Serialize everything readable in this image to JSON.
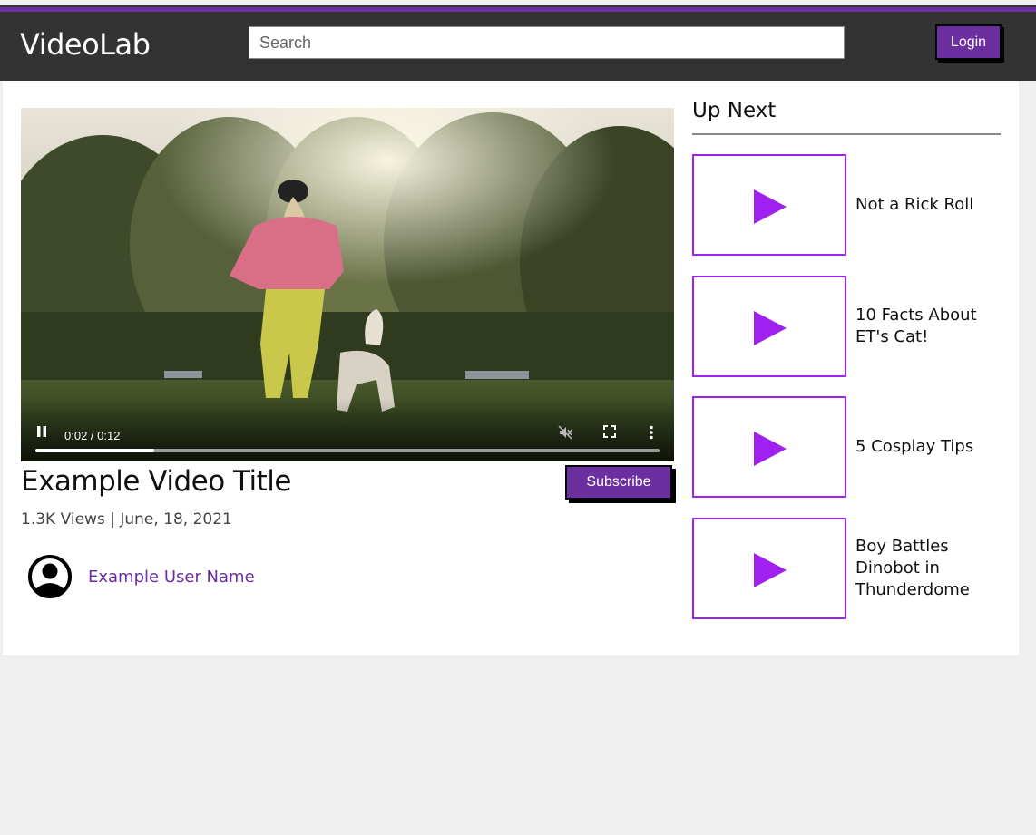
{
  "header": {
    "logo": "VideoLab",
    "search_placeholder": "Search",
    "login_label": "Login",
    "accent_color": "#6b2fa0",
    "background_color": "#333333"
  },
  "player": {
    "current_time": "0:02",
    "duration": "0:12",
    "time_display": "0:02 / 0:12",
    "progress_fraction": 0.19,
    "icons": [
      "pause-icon",
      "mute-icon",
      "fullscreen-icon",
      "more-options-icon"
    ]
  },
  "video": {
    "title": "Example Video Title",
    "subscribe_label": "Subscribe",
    "meta": "1.3K Views | June, 18, 2021",
    "user_name": "Example User Name"
  },
  "up_next": {
    "heading": "Up Next",
    "thumbnail_border_color": "#a020f0",
    "items": [
      {
        "title": "Not a Rick Roll"
      },
      {
        "title": "10 Facts About ET's Cat!"
      },
      {
        "title": "5 Cosplay Tips"
      },
      {
        "title": "Boy Battles Dinobot in Thunderdome"
      }
    ]
  }
}
